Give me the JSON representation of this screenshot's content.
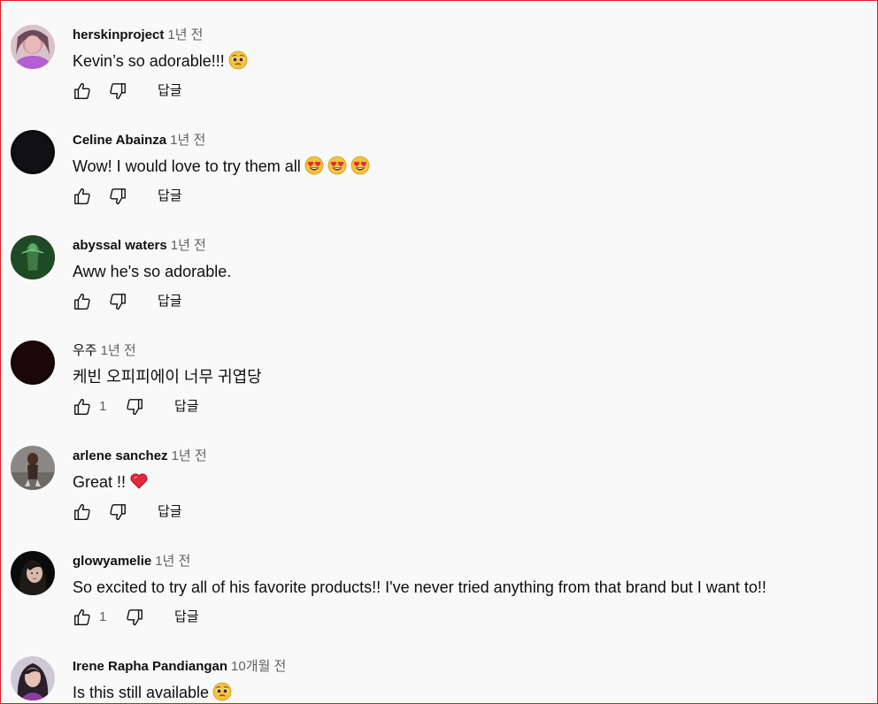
{
  "ui": {
    "reply_label": "답글"
  },
  "comments": [
    {
      "author": "herskinproject",
      "time": "1년 전",
      "text": "Kevin’s so adorable!!!",
      "emoji": [
        "pleading-face"
      ],
      "likes": ""
    },
    {
      "author": "Celine Abainza",
      "time": "1년 전",
      "text": "Wow! I would love to try them all",
      "emoji": [
        "heart-eyes",
        "heart-eyes",
        "heart-eyes"
      ],
      "likes": ""
    },
    {
      "author": "abyssal waters",
      "time": "1년 전",
      "text": "Aww he's so adorable.",
      "emoji": [],
      "likes": ""
    },
    {
      "author": "우주",
      "time": "1년 전",
      "text": "케빈 오피피에이 너무 귀엽당",
      "emoji": [],
      "likes": "1"
    },
    {
      "author": "arlene sanchez",
      "time": "1년 전",
      "text": "Great !!",
      "emoji": [
        "red-heart"
      ],
      "likes": ""
    },
    {
      "author": "glowyamelie",
      "time": "1년 전",
      "text": "So excited to try all of his favorite products!! I've never tried anything from that brand but I want to!!",
      "emoji": [],
      "likes": "1"
    },
    {
      "author": "Irene Rapha Pandiangan",
      "time": "10개월 전",
      "text": "Is this still available",
      "emoji": [
        "pleading-face"
      ],
      "likes": ""
    }
  ],
  "colors": {
    "background": "#f9f9f9",
    "text_primary": "#0f0f0f",
    "text_secondary": "#606060",
    "frame_border": "#e01b24"
  }
}
